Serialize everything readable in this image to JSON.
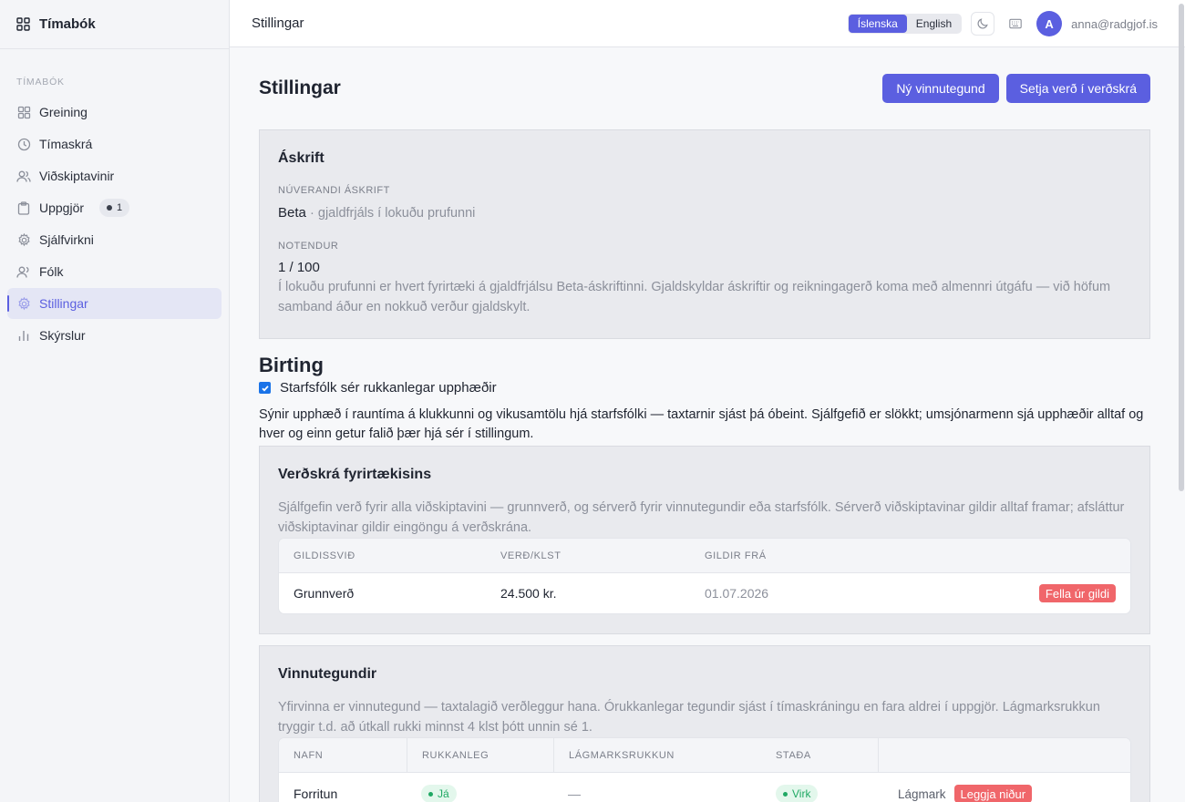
{
  "sidebar": {
    "brand": "Tímabók",
    "heading": "Tímabók",
    "items": [
      {
        "label": "Greining",
        "icon": "dashboard-grid-icon"
      },
      {
        "label": "Tímaskrá",
        "icon": "clock-icon"
      },
      {
        "label": "Viðskiptavinir",
        "icon": "users-icon"
      },
      {
        "label": "Uppgjör",
        "icon": "clipboard-icon",
        "badge": "1"
      },
      {
        "label": "Sjálfvirkni",
        "icon": "gear-icon"
      },
      {
        "label": "Fólk",
        "icon": "people-icon"
      },
      {
        "label": "Stillingar",
        "icon": "settings-icon",
        "active": true
      },
      {
        "label": "Skýrslur",
        "icon": "bar-chart-icon"
      }
    ]
  },
  "topbar": {
    "title": "Stillingar",
    "lang_is": "Íslenska",
    "lang_en": "English",
    "avatar_initial": "A",
    "email": "anna@radgjof.is"
  },
  "page": {
    "title": "Stillingar",
    "btn_new_worktype": "Ný vinnutegund",
    "btn_set_price": "Setja verð í verðskrá"
  },
  "subscription": {
    "title": "Áskrift",
    "current_label": "Núverandi áskrift",
    "plan": "Beta",
    "plan_note": "· gjaldfrjáls í lokuðu prufunni",
    "users_label": "Notendur",
    "users_value": "1 / 100",
    "description": "Í lokuðu prufunni er hvert fyrirtæki á gjaldfrjálsu Beta-áskriftinni. Gjaldskyldar áskriftir og reikningagerð koma með almennri útgáfu — við höfum samband áður en nokkuð verður gjaldskylt."
  },
  "display": {
    "title": "Birting",
    "checkbox_label": "Starfsfólk sér rukkanlegar upphæðir",
    "checked": true,
    "description": "Sýnir upphæð í rauntíma á klukkunni og vikusamtölu hjá starfsfólki — taxtarnir sjást þá óbeint. Sjálfgefið er slökkt; umsjónarmenn sjá upphæðir alltaf og hver og einn getur falið þær hjá sér í stillingum."
  },
  "pricelist": {
    "title": "Verðskrá fyrirtækisins",
    "description": "Sjálfgefin verð fyrir alla viðskiptavini — grunnverð, og sérverð fyrir vinnutegundir eða starfsfólk. Sérverð viðskiptavinar gildir alltaf framar; afsláttur viðskiptavinar gildir eingöngu á verðskrána.",
    "columns": [
      "Gildissvið",
      "Verð/klst",
      "Gildir frá"
    ],
    "rows": [
      {
        "scope": "Grunnverð",
        "price": "24.500 kr.",
        "from": "01.07.2026",
        "action": "Fella úr gildi"
      }
    ]
  },
  "worktypes": {
    "title": "Vinnutegundir",
    "description": "Yfirvinna er vinnutegund — taxtalagið verðleggur hana. Órukkanlegar tegundir sjást í tímaskráningu en fara aldrei í uppgjör. Lágmarksrukkun tryggir t.d. að útkall rukki minnst 4 klst þótt unnin sé 1.",
    "columns": [
      "Nafn",
      "Rukkanleg",
      "Lágmarksrukkun",
      "Staða"
    ],
    "rows": [
      {
        "name": "Forritun",
        "billable": "Já",
        "minimum": "—",
        "status": "Virk",
        "action_min": "Lágmark",
        "action_remove": "Leggja niður"
      }
    ]
  }
}
